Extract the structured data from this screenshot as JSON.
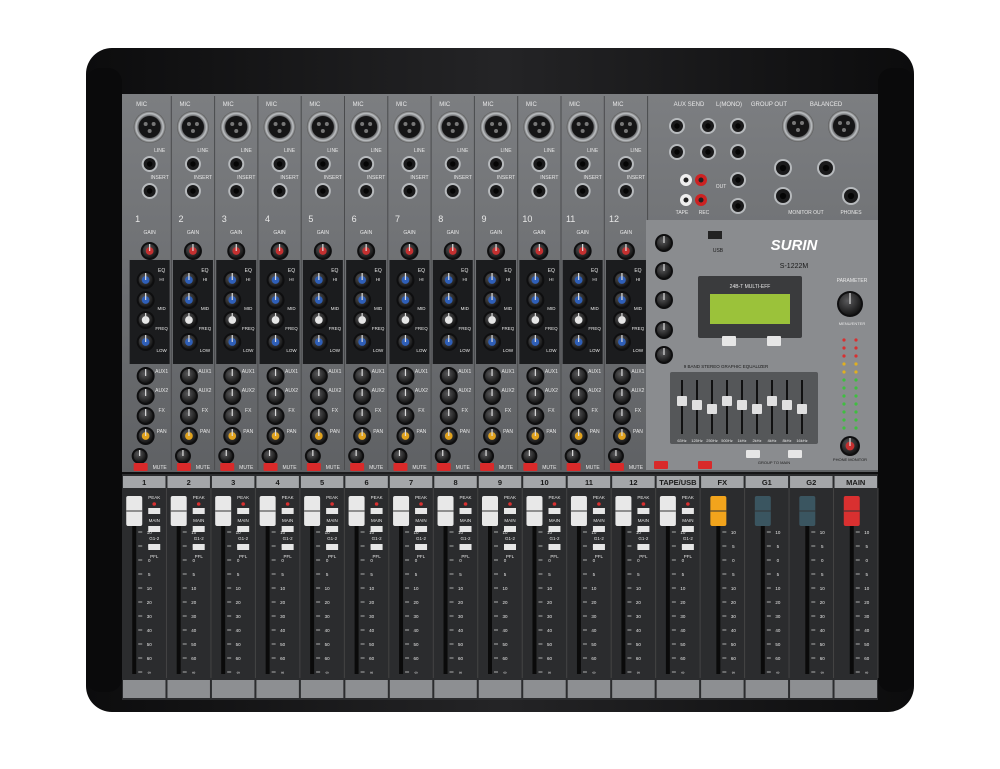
{
  "brand": {
    "name": "SURIN",
    "model": "S-1222M"
  },
  "channels": [
    "1",
    "2",
    "3",
    "4",
    "5",
    "6",
    "7",
    "8",
    "9",
    "10",
    "11",
    "12"
  ],
  "channel_section_labels": {
    "mic": "MIC",
    "line": "LINE",
    "insert": "INSERT",
    "gain": "GAIN",
    "eq": "EQ",
    "hi": "HI",
    "mid": "MID",
    "freq": "FREQ",
    "low": "LOW",
    "aux1": "AUX1",
    "aux2": "AUX2",
    "fx": "FX",
    "pan": "PAN",
    "mute": "MUTE",
    "peak": "PEAK",
    "main": "MAIN",
    "g12": "G1-2",
    "pfl": "PFL"
  },
  "fader_strips": [
    "1",
    "2",
    "3",
    "4",
    "5",
    "6",
    "7",
    "8",
    "9",
    "10",
    "11",
    "12",
    "TAPE/USB",
    "FX",
    "G1",
    "G2",
    "MAIN"
  ],
  "fader_scale": [
    "10",
    "5",
    "0",
    "5",
    "10",
    "20",
    "30",
    "40",
    "50",
    "60",
    "∞"
  ],
  "master_labels": {
    "aux_send": "AUX SEND",
    "l_mono": "L(MONO)",
    "group_out": "GROUP OUT",
    "balanced": "BALANCED",
    "out": "OUT",
    "tape": "TAPE",
    "rec": "REC",
    "monitor_out": "MONITOR OUT",
    "phones": "PHONES",
    "parameter": "PARAMETER",
    "menu_enter": "MENU/ENTER",
    "display_text": "24B-T MULTI-EFF",
    "eq_title": "9 BAND STEREO GRAPHIC EQUALIZER",
    "phone_monitor": "PHONE MONITOR",
    "group_to_main": "GROUP TO MAIN",
    "usb": "USB"
  },
  "eq_bands": [
    "63Hz",
    "125Hz",
    "250Hz",
    "500Hz",
    "1kHz",
    "2kHz",
    "4kHz",
    "8kHz",
    "16kHz"
  ],
  "colors": {
    "chassis": "#1c1c1e",
    "panel": "#6e7073",
    "panel_dark": "#2d2e30",
    "mute_red": "#d92a2a",
    "eq_blue": "#2f5fb8",
    "pan_yellow": "#e0a21e",
    "gain_red": "#c43030",
    "lcd": "#9bc23a"
  }
}
